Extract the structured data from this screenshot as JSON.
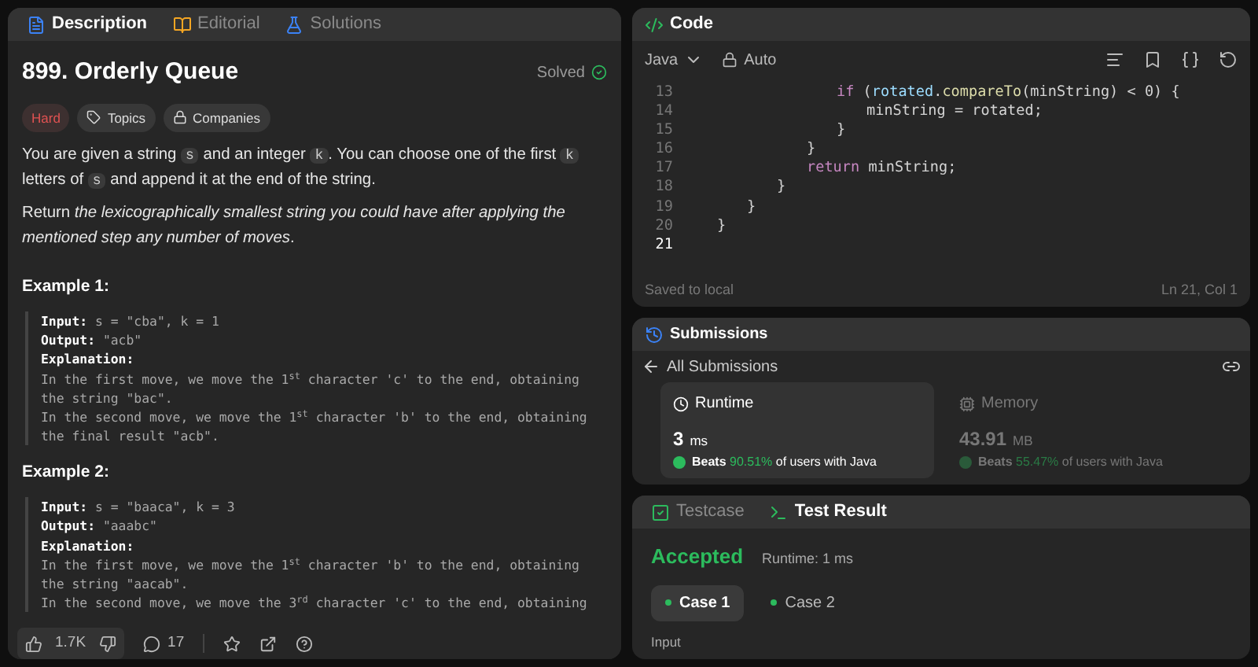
{
  "left_tabs": [
    {
      "label": "Description",
      "selected": true
    },
    {
      "label": "Editorial",
      "selected": false
    },
    {
      "label": "Solutions",
      "selected": false
    }
  ],
  "problem": {
    "title": "899. Orderly Queue",
    "status": "Solved",
    "tags": [
      {
        "label": "Hard",
        "kind": "difficulty"
      },
      {
        "label": "Topics",
        "kind": "topics"
      },
      {
        "label": "Companies",
        "kind": "companies"
      }
    ],
    "paragraphs": [
      [
        {
          "kind": "text",
          "text": "You are given a string "
        },
        {
          "kind": "code",
          "text": "s"
        },
        {
          "kind": "text",
          "text": " and an integer "
        },
        {
          "kind": "code",
          "text": "k"
        },
        {
          "kind": "text",
          "text": ". You can choose one of the first "
        },
        {
          "kind": "code",
          "text": "k"
        },
        {
          "kind": "text",
          "text": " letters of "
        },
        {
          "kind": "code",
          "text": "s"
        },
        {
          "kind": "text",
          "text": " and append it at the end of the string."
        }
      ],
      [
        {
          "kind": "text",
          "text": "Return "
        },
        {
          "kind": "italic",
          "text": "the lexicographically smallest string you could have after applying the mentioned step any number of moves"
        },
        {
          "kind": "text",
          "text": "."
        }
      ]
    ],
    "examples": [
      {
        "title": "Example 1:",
        "input_label": "Input:",
        "input": "s = \"cba\", k = 1",
        "output_label": "Output:",
        "output": "\"acb\"",
        "explanation_label": "Explanation:",
        "explanation": [
          "In the first move, we move the 1$^{st}$ character 'c' to the end, obtaining the string \"bac\".",
          "In the second move, we move the 1$^{st}$ character 'b' to the end, obtaining the final result \"acb\"."
        ]
      },
      {
        "title": "Example 2:",
        "input_label": "Input:",
        "input": "s = \"baaca\", k = 3",
        "output_label": "Output:",
        "output": "\"aaabc\"",
        "explanation_label": "Explanation:",
        "explanation": [
          "In the first move, we move the 1$^{st}$ character 'b' to the end, obtaining the string \"aacab\".",
          "In the second move, we move the 3$^{rd}$ character 'c' to the end, obtaining"
        ]
      }
    ]
  },
  "footer": {
    "likes": "1.7K",
    "comments": "17"
  },
  "code_panel": {
    "title": "Code",
    "language": "Java",
    "mode": "Auto",
    "status": "Saved to local",
    "cursor": "Ln 21, Col 1",
    "lines": [
      {
        "children": [
          {
            "children": [
              {
                "children": [
                  {
                    "children": [
                      {
                        "number": "13",
                        "tokens": [
                          {
                            "kind": "keyword",
                            "text": "if"
                          },
                          {
                            "kind": "plain",
                            "text": " ("
                          },
                          {
                            "kind": "variable",
                            "text": "rotated"
                          },
                          {
                            "kind": "plain",
                            "text": "."
                          },
                          {
                            "kind": "method",
                            "text": "compareTo"
                          },
                          {
                            "kind": "plain",
                            "text": "(minString) < 0) {"
                          }
                        ]
                      },
                      {
                        "children": [
                          {
                            "number": "14",
                            "tokens": [
                              {
                                "kind": "plain",
                                "text": "minString = rotated;"
                              }
                            ]
                          }
                        ]
                      },
                      {
                        "number": "15",
                        "tokens": [
                          {
                            "kind": "plain",
                            "text": "}"
                          }
                        ]
                      }
                    ]
                  },
                  {
                    "number": "16",
                    "tokens": [
                      {
                        "kind": "plain",
                        "text": "}"
                      }
                    ]
                  },
                  {
                    "number": "17",
                    "tokens": [
                      {
                        "kind": "keyword",
                        "text": "return"
                      },
                      {
                        "kind": "plain",
                        "text": " minString;"
                      }
                    ]
                  }
                ]
              },
              {
                "number": "18",
                "tokens": [
                  {
                    "kind": "plain",
                    "text": "}"
                  }
                ]
              }
            ]
          },
          {
            "number": "19",
            "tokens": [
              {
                "kind": "plain",
                "text": "}"
              }
            ]
          }
        ]
      },
      {
        "number": "20",
        "tokens": [
          {
            "kind": "plain",
            "text": "}"
          }
        ]
      },
      {
        "number": "21",
        "current": true
      }
    ]
  },
  "submissions": {
    "title": "Submissions",
    "back_label": "All Submissions",
    "cards": [
      {
        "label": "Runtime",
        "value": "3",
        "unit": "ms",
        "beats": "Beats",
        "percent": "90.51%",
        "suffix": "of users with Java",
        "selected": true
      },
      {
        "label": "Memory",
        "value": "43.91",
        "unit": "MB",
        "beats": "Beats",
        "percent": "55.47%",
        "suffix": "of users with Java",
        "selected": false
      }
    ]
  },
  "test_panel": {
    "tabs": [
      {
        "label": "Testcase",
        "selected": false
      },
      {
        "label": "Test Result",
        "selected": true
      }
    ],
    "result": "Accepted",
    "runtime": "Runtime: 1 ms",
    "cases": [
      {
        "label": "Case 1",
        "selected": true
      },
      {
        "label": "Case 2",
        "selected": false
      }
    ],
    "input_label": "Input"
  }
}
